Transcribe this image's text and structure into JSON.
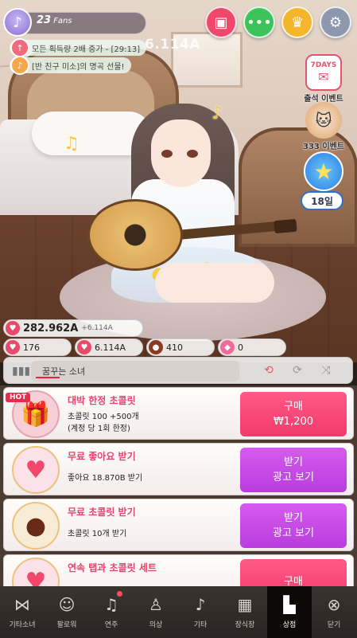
{
  "hud": {
    "fans_count": "23",
    "fans_label": "Fans",
    "floating_value": "6.114A",
    "notices": [
      "모든 획득량 2배 증가 - [29:13]",
      "[반 친구 미소]의 명곡 선물!"
    ],
    "top_buttons": [
      {
        "icon": "card-icon",
        "color": "#f0486b"
      },
      {
        "icon": "chat-icon",
        "color": "#3cc45a"
      },
      {
        "icon": "trophy-icon",
        "color": "#f6b62c"
      },
      {
        "icon": "gear-icon",
        "color": "#8e98ad"
      }
    ],
    "side_events": [
      {
        "label": "출석 이벤트",
        "icon": "calendar-icon",
        "tag": "7DAYS"
      },
      {
        "label": "333 이벤트",
        "icon": "cat-icon"
      }
    ],
    "day_badge": "18일"
  },
  "stats": {
    "heart_total": "282.962A",
    "heart_rate": "+6.114A",
    "items": [
      {
        "value": "176",
        "icon": "heart-gift-icon",
        "color": "#e84a6b"
      },
      {
        "value": "6.114A",
        "icon": "heart-box-icon",
        "color": "#e84a6b"
      },
      {
        "value": "410",
        "icon": "chocolate-icon",
        "color": "#8a3b24"
      },
      {
        "value": "0",
        "icon": "candy-icon",
        "color": "#f06b9a"
      }
    ]
  },
  "music": {
    "title": "꿈꾸는 소녀",
    "progress": 0.12
  },
  "shop": {
    "items": [
      {
        "badge": "HOT",
        "title": "대박 한정 초콜릿",
        "desc_lines": [
          "초콜릿 100 +500개",
          "(계정 당 1회 한정)"
        ],
        "button_lines": [
          "구매",
          "₩1,200"
        ],
        "button_kind": "buy",
        "thumb_icon": "chocolate-box-icon"
      },
      {
        "badge": "",
        "title": "무료 좋아요 받기",
        "desc_lines": [
          "좋아요 18.870B 받기"
        ],
        "button_lines": [
          "받기",
          "광고 보기"
        ],
        "button_kind": "ad",
        "thumb_icon": "heart-icon"
      },
      {
        "badge": "",
        "title": "무료 초콜릿 받기",
        "desc_lines": [
          "초콜릿 10개 받기"
        ],
        "button_lines": [
          "받기",
          "광고 보기"
        ],
        "button_kind": "ad",
        "thumb_icon": "chocolate-icon"
      },
      {
        "badge": "",
        "title": "연속 탭과 초콜릿 세트",
        "desc_lines": [],
        "button_lines": [
          "구매"
        ],
        "button_kind": "buy",
        "thumb_icon": "heart-icon"
      }
    ]
  },
  "nav": {
    "items": [
      {
        "label": "기타소녀",
        "icon": "ribbon-icon"
      },
      {
        "label": "팔로워",
        "icon": "followers-icon"
      },
      {
        "label": "연주",
        "icon": "music-note-icon",
        "dot": true
      },
      {
        "label": "의상",
        "icon": "dress-icon"
      },
      {
        "label": "기타",
        "icon": "guitar-icon"
      },
      {
        "label": "장식장",
        "icon": "gift-icon"
      },
      {
        "label": "상점",
        "icon": "shop-icon",
        "active": true
      },
      {
        "label": "닫기",
        "icon": "close-icon"
      }
    ]
  }
}
